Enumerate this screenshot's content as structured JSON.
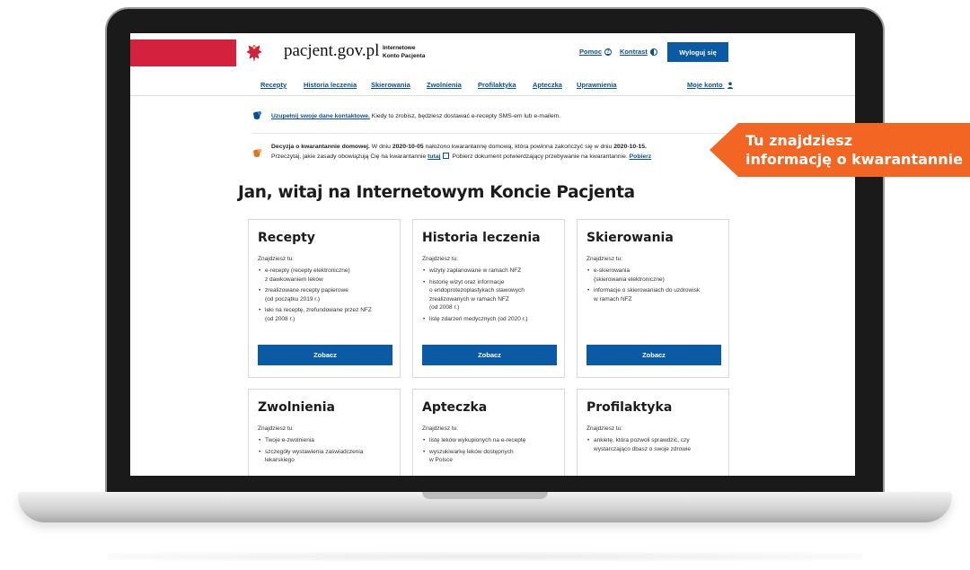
{
  "header": {
    "site_name": "pacjent.gov.pl",
    "site_sub_1": "Internetowe",
    "site_sub_2": "Konto Pacjenta",
    "help_label": "Pomoc",
    "contrast_label": "Kontrast",
    "logout_label": "Wyloguj się"
  },
  "nav": {
    "items": [
      "Recepty",
      "Historia leczenia",
      "Skierowania",
      "Zwolnienia",
      "Profilaktyka",
      "Apteczka",
      "Uprawnienia"
    ],
    "account_label": "Moje konto"
  },
  "notices": {
    "contact": {
      "link": "Uzupełnij swoje dane kontaktowe.",
      "text": " Kiedy to zrobisz, będziesz dostawać e-recepty SMS-em lub e-mailem."
    },
    "quarantine": {
      "bold": "Decyzja o kwarantannie domowej.",
      "text_1": " W dniu ",
      "date_start": "2020-10-05",
      "text_2": " nałożono kwarantannę domową, która powinna zakończyć się w dniu ",
      "date_end": "2020-10-15.",
      "line2_1": "Przeczytaj, jakie zasady obowiązują Cię na kwarantannie ",
      "link_here": "tutaj",
      "line2_2": " Pobierz dokument potwierdzający przebywanie na kwarantannie. ",
      "link_download": "Pobierz"
    }
  },
  "welcome": "Jan, witaj na Internetowym Koncie Pacjenta",
  "cards": [
    {
      "title": "Recepty",
      "intro": "Znajdziesz tu:",
      "items": [
        "e-recepty (recepty elektroniczne)\nz dawkowaniem leków",
        "zrealizowane recepty papierowe\n(od początku 2019 r.)",
        "leki na receptę, zrefundowane przez NFZ\n(od 2008 r.)"
      ],
      "button": "Zobacz"
    },
    {
      "title": "Historia leczenia",
      "intro": "Znajdziesz tu:",
      "items": [
        "wizyty zaplanowane w ramach NFZ",
        "historię wizyt oraz informacje\no endoprotezoplastykach stawowych\nzrealizowanych w ramach NFZ\n(od 2008 r.)",
        "listę zdarzeń medycznych (od 2020 r.)"
      ],
      "button": "Zobacz"
    },
    {
      "title": "Skierowania",
      "intro": "Znajdziesz tu:",
      "items": [
        "e-skierowania\n(skierowania elektroniczne)",
        "informacje o skierowaniach do uzdrowisk\nw ramach NFZ"
      ],
      "button": "Zobacz"
    },
    {
      "title": "Zwolnienia",
      "intro": "Znajdziesz tu:",
      "items": [
        "Twoje e-zwolnienia",
        "szczegóły wystawienia zaświadczenia\nlekarskiego"
      ]
    },
    {
      "title": "Apteczka",
      "intro": "Znajdziesz tu:",
      "items": [
        "listę leków wykupionych na e-receptę",
        "wyszukiwarkę leków dostępnych\nw Polsce"
      ]
    },
    {
      "title": "Profilaktyka",
      "intro": "Znajdziesz tu:",
      "items": [
        "ankietę, która pozwoli sprawdzić, czy\nwystarczająco dbasz o swoje zdrowie"
      ]
    }
  ],
  "callout": {
    "line1": "Tu znajdziesz",
    "line2": "informację o kwarantannie"
  },
  "colors": {
    "brand_red": "#d4213d",
    "brand_blue": "#0b5aa5",
    "link_blue": "#0b4f91",
    "callout_orange": "#f26522"
  }
}
